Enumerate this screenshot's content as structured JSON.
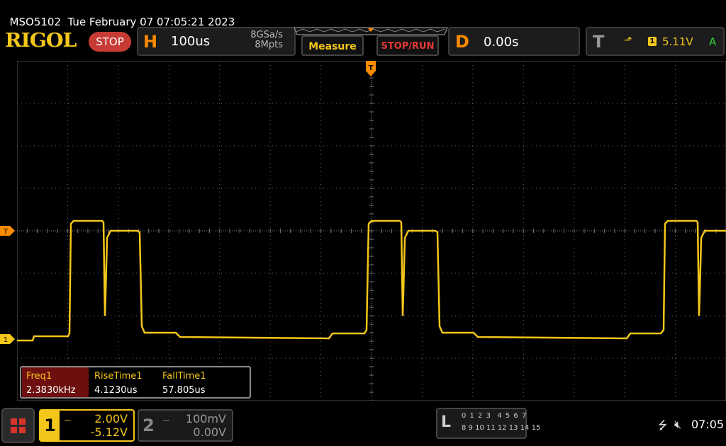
{
  "status": {
    "model": "MSO5102",
    "datetime": "Tue February 07 07:05:21 2023"
  },
  "brand": {
    "logo": "RIGOL",
    "run_state": "STOP"
  },
  "horizontal": {
    "label": "H",
    "timebase": "100us",
    "sample_rate": "8GSa/s",
    "memory_depth": "8Mpts"
  },
  "buttons": {
    "measure": "Measure",
    "stop_run": "STOP/RUN"
  },
  "delay": {
    "label": "D",
    "value": "0.00s"
  },
  "trigger": {
    "label": "T",
    "edge_icon": "rising-edge-icon",
    "edge_glyph": "⬏",
    "source": "1",
    "level": "5.11V",
    "mode": "A"
  },
  "markers": {
    "trigger_position": "T",
    "trigger_level": "T",
    "ch1_ground": "1"
  },
  "measurements": [
    {
      "name": "Freq1",
      "value": "2.3830kHz"
    },
    {
      "name": "RiseTime1",
      "value": "4.1230us"
    },
    {
      "name": "FallTime1",
      "value": "57.805us"
    }
  ],
  "channel1": {
    "number": "1",
    "coupling": "DC",
    "scale": "2.00V",
    "offset": "-5.12V",
    "color": "#f3c61a"
  },
  "channel2": {
    "number": "2",
    "coupling": "DC",
    "scale": "100mV",
    "offset": "0.00V",
    "color": "#888888"
  },
  "logic_analyzer": {
    "label": "L",
    "row1": "0 1 2 3  4 5 6 7",
    "row2": "8 9 10 11 12 13 14 15"
  },
  "system": {
    "usb_icon": "usb-icon",
    "speaker_icon": "speaker-muted-icon",
    "time": "07:05"
  },
  "colors": {
    "accent": "#f3c61a",
    "horizontal": "#ff8a00",
    "stop": "#c73b35",
    "trigger_mode": "#2fd43c"
  }
}
